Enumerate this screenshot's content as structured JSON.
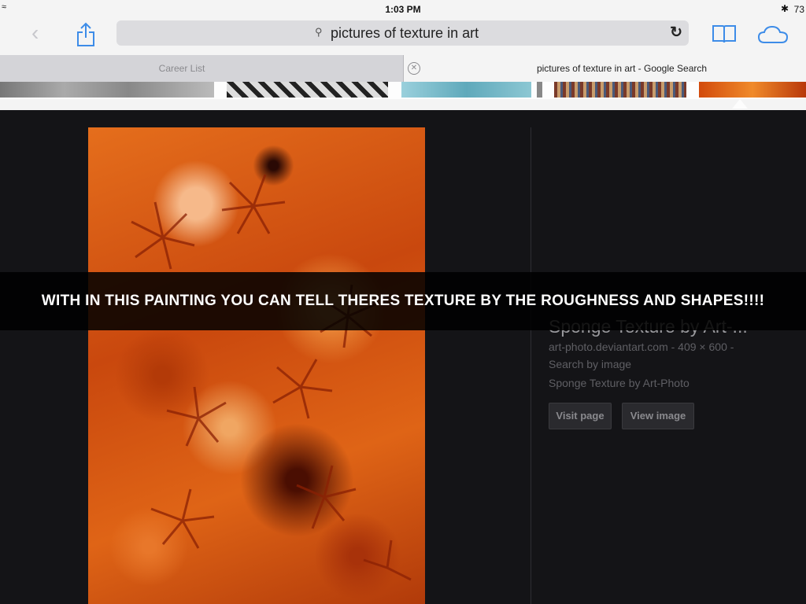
{
  "status_bar": {
    "time": "1:03 PM",
    "battery": "73"
  },
  "toolbar": {
    "back_icon": "chevron-left-icon",
    "share_icon": "share-icon",
    "search_query": "pictures of texture in art",
    "reload_icon": "reload-icon",
    "bookmarks_icon": "book-icon",
    "cloud_icon": "cloud-icon"
  },
  "tabs": [
    {
      "label": "Career List",
      "active": false
    },
    {
      "label": "pictures of texture in art - Google Search",
      "active": true
    }
  ],
  "result": {
    "title": "Sponge Texture by Art-...",
    "meta_line1": "art-photo.deviantart.com - 409 × 600 -",
    "meta_line2": "Search by image",
    "description": "Sponge Texture by Art-Photo",
    "visit_label": "Visit page",
    "view_label": "View image"
  },
  "caption": {
    "text": "WITH IN THIS PAINTING YOU CAN TELL THERES TEXTURE BY THE ROUGHNESS AND SHAPES!!!!"
  },
  "colors": {
    "accent": "#3d8ce8",
    "background": "#141417"
  }
}
